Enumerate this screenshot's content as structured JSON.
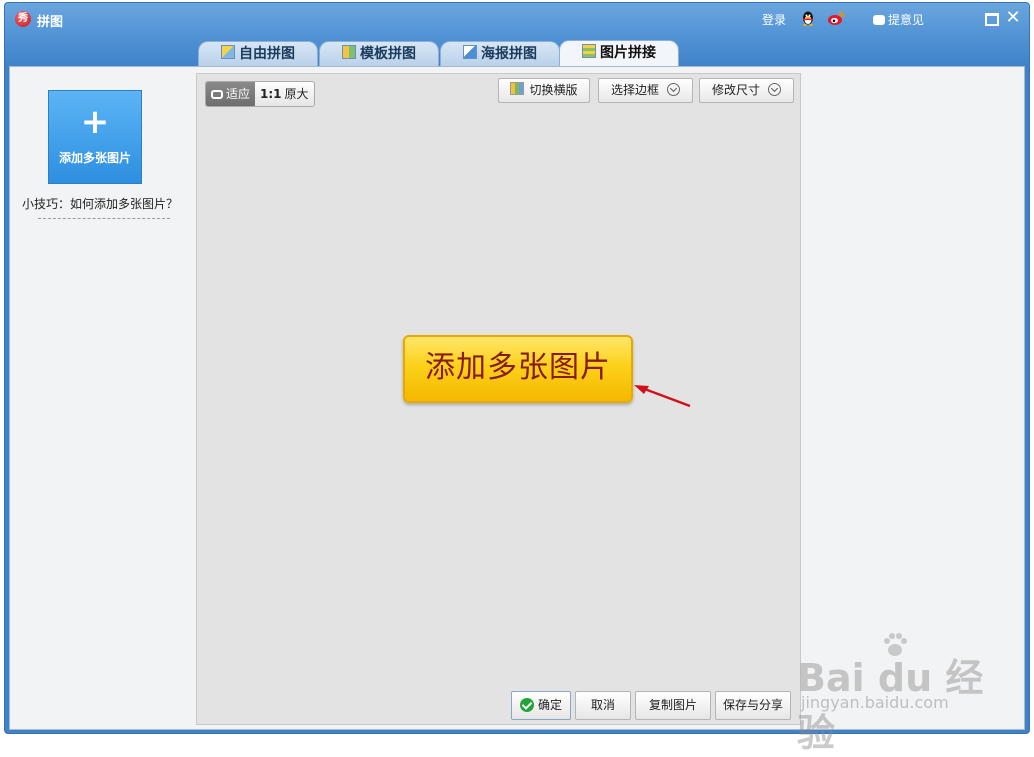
{
  "window": {
    "title": "拼图",
    "logo_char": "秀",
    "login": "登录",
    "feedback": "提意见",
    "close_symbol": "✕"
  },
  "tabs": [
    {
      "label": "自由拼图",
      "active": false
    },
    {
      "label": "模板拼图",
      "active": false
    },
    {
      "label": "海报拼图",
      "active": false
    },
    {
      "label": "图片拼接",
      "active": true
    }
  ],
  "sidebar": {
    "add_tile_symbol": "+",
    "add_tile_label": "添加多张图片",
    "tip": "小技巧：如何添加多张图片？"
  },
  "canvas_toolbar": {
    "fit_label": "适应",
    "original_prefix": "1:1",
    "original_label": "原大",
    "switch_layout": "切换横版",
    "select_border": "选择边框",
    "resize": "修改尺寸"
  },
  "canvas": {
    "add_button": "添加多张图片"
  },
  "actions": {
    "confirm": "确定",
    "cancel": "取消",
    "copy": "复制图片",
    "save_share": "保存与分享"
  },
  "watermark": {
    "main": "Bai du 经验",
    "url": "jingyan.baidu.com"
  },
  "colors": {
    "titlebar": "#4d8fd2",
    "accent_yellow": "#fcd11a",
    "add_tile_blue": "#2e8fe0",
    "arrow_red": "#d0101a"
  }
}
